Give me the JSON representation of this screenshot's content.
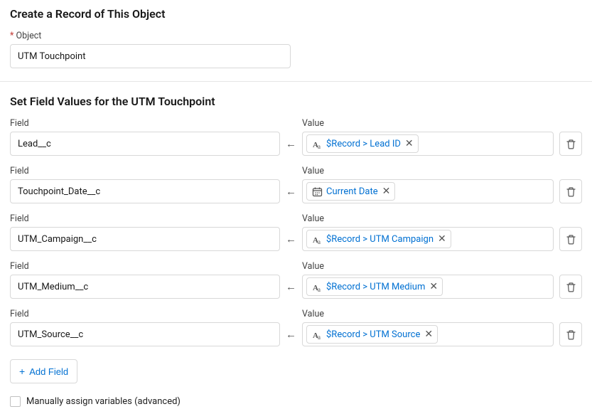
{
  "header": {
    "title": "Create a Record of This Object",
    "object_label": "Object",
    "object_value": "UTM Touchpoint"
  },
  "fields_section": {
    "title": "Set Field Values for the UTM Touchpoint",
    "field_label": "Field",
    "value_label": "Value"
  },
  "mappings": [
    {
      "field": "Lead__c",
      "value_text": "$Record > Lead ID",
      "icon": "text"
    },
    {
      "field": "Touchpoint_Date__c",
      "value_text": "Current Date",
      "icon": "date"
    },
    {
      "field": "UTM_Campaign__c",
      "value_text": "$Record > UTM Campaign",
      "icon": "text"
    },
    {
      "field": "UTM_Medium__c",
      "value_text": "$Record > UTM Medium",
      "icon": "text"
    },
    {
      "field": "UTM_Source__c",
      "value_text": "$Record > UTM Source",
      "icon": "text"
    }
  ],
  "add_field_label": "Add Field",
  "checkbox_label": "Manually assign variables (advanced)"
}
